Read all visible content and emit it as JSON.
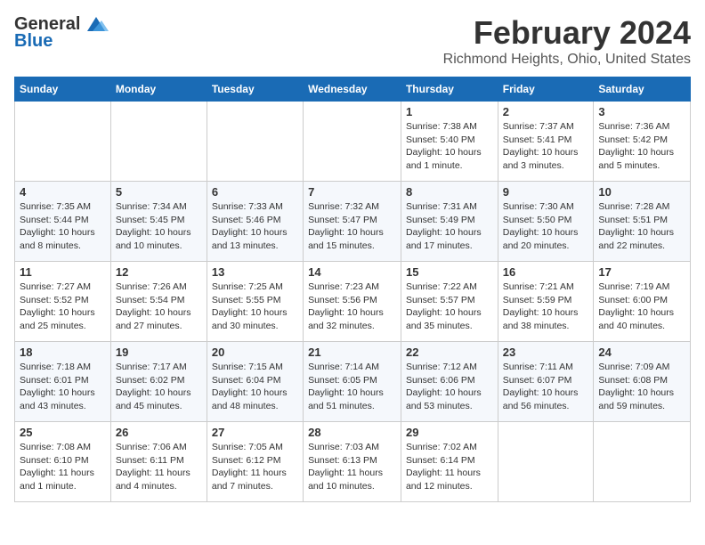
{
  "header": {
    "logo_general": "General",
    "logo_blue": "Blue",
    "month_year": "February 2024",
    "location": "Richmond Heights, Ohio, United States"
  },
  "days_of_week": [
    "Sunday",
    "Monday",
    "Tuesday",
    "Wednesday",
    "Thursday",
    "Friday",
    "Saturday"
  ],
  "weeks": [
    [
      {
        "day": "",
        "info": ""
      },
      {
        "day": "",
        "info": ""
      },
      {
        "day": "",
        "info": ""
      },
      {
        "day": "",
        "info": ""
      },
      {
        "day": "1",
        "info": "Sunrise: 7:38 AM\nSunset: 5:40 PM\nDaylight: 10 hours and 1 minute."
      },
      {
        "day": "2",
        "info": "Sunrise: 7:37 AM\nSunset: 5:41 PM\nDaylight: 10 hours and 3 minutes."
      },
      {
        "day": "3",
        "info": "Sunrise: 7:36 AM\nSunset: 5:42 PM\nDaylight: 10 hours and 5 minutes."
      }
    ],
    [
      {
        "day": "4",
        "info": "Sunrise: 7:35 AM\nSunset: 5:44 PM\nDaylight: 10 hours and 8 minutes."
      },
      {
        "day": "5",
        "info": "Sunrise: 7:34 AM\nSunset: 5:45 PM\nDaylight: 10 hours and 10 minutes."
      },
      {
        "day": "6",
        "info": "Sunrise: 7:33 AM\nSunset: 5:46 PM\nDaylight: 10 hours and 13 minutes."
      },
      {
        "day": "7",
        "info": "Sunrise: 7:32 AM\nSunset: 5:47 PM\nDaylight: 10 hours and 15 minutes."
      },
      {
        "day": "8",
        "info": "Sunrise: 7:31 AM\nSunset: 5:49 PM\nDaylight: 10 hours and 17 minutes."
      },
      {
        "day": "9",
        "info": "Sunrise: 7:30 AM\nSunset: 5:50 PM\nDaylight: 10 hours and 20 minutes."
      },
      {
        "day": "10",
        "info": "Sunrise: 7:28 AM\nSunset: 5:51 PM\nDaylight: 10 hours and 22 minutes."
      }
    ],
    [
      {
        "day": "11",
        "info": "Sunrise: 7:27 AM\nSunset: 5:52 PM\nDaylight: 10 hours and 25 minutes."
      },
      {
        "day": "12",
        "info": "Sunrise: 7:26 AM\nSunset: 5:54 PM\nDaylight: 10 hours and 27 minutes."
      },
      {
        "day": "13",
        "info": "Sunrise: 7:25 AM\nSunset: 5:55 PM\nDaylight: 10 hours and 30 minutes."
      },
      {
        "day": "14",
        "info": "Sunrise: 7:23 AM\nSunset: 5:56 PM\nDaylight: 10 hours and 32 minutes."
      },
      {
        "day": "15",
        "info": "Sunrise: 7:22 AM\nSunset: 5:57 PM\nDaylight: 10 hours and 35 minutes."
      },
      {
        "day": "16",
        "info": "Sunrise: 7:21 AM\nSunset: 5:59 PM\nDaylight: 10 hours and 38 minutes."
      },
      {
        "day": "17",
        "info": "Sunrise: 7:19 AM\nSunset: 6:00 PM\nDaylight: 10 hours and 40 minutes."
      }
    ],
    [
      {
        "day": "18",
        "info": "Sunrise: 7:18 AM\nSunset: 6:01 PM\nDaylight: 10 hours and 43 minutes."
      },
      {
        "day": "19",
        "info": "Sunrise: 7:17 AM\nSunset: 6:02 PM\nDaylight: 10 hours and 45 minutes."
      },
      {
        "day": "20",
        "info": "Sunrise: 7:15 AM\nSunset: 6:04 PM\nDaylight: 10 hours and 48 minutes."
      },
      {
        "day": "21",
        "info": "Sunrise: 7:14 AM\nSunset: 6:05 PM\nDaylight: 10 hours and 51 minutes."
      },
      {
        "day": "22",
        "info": "Sunrise: 7:12 AM\nSunset: 6:06 PM\nDaylight: 10 hours and 53 minutes."
      },
      {
        "day": "23",
        "info": "Sunrise: 7:11 AM\nSunset: 6:07 PM\nDaylight: 10 hours and 56 minutes."
      },
      {
        "day": "24",
        "info": "Sunrise: 7:09 AM\nSunset: 6:08 PM\nDaylight: 10 hours and 59 minutes."
      }
    ],
    [
      {
        "day": "25",
        "info": "Sunrise: 7:08 AM\nSunset: 6:10 PM\nDaylight: 11 hours and 1 minute."
      },
      {
        "day": "26",
        "info": "Sunrise: 7:06 AM\nSunset: 6:11 PM\nDaylight: 11 hours and 4 minutes."
      },
      {
        "day": "27",
        "info": "Sunrise: 7:05 AM\nSunset: 6:12 PM\nDaylight: 11 hours and 7 minutes."
      },
      {
        "day": "28",
        "info": "Sunrise: 7:03 AM\nSunset: 6:13 PM\nDaylight: 11 hours and 10 minutes."
      },
      {
        "day": "29",
        "info": "Sunrise: 7:02 AM\nSunset: 6:14 PM\nDaylight: 11 hours and 12 minutes."
      },
      {
        "day": "",
        "info": ""
      },
      {
        "day": "",
        "info": ""
      }
    ]
  ]
}
